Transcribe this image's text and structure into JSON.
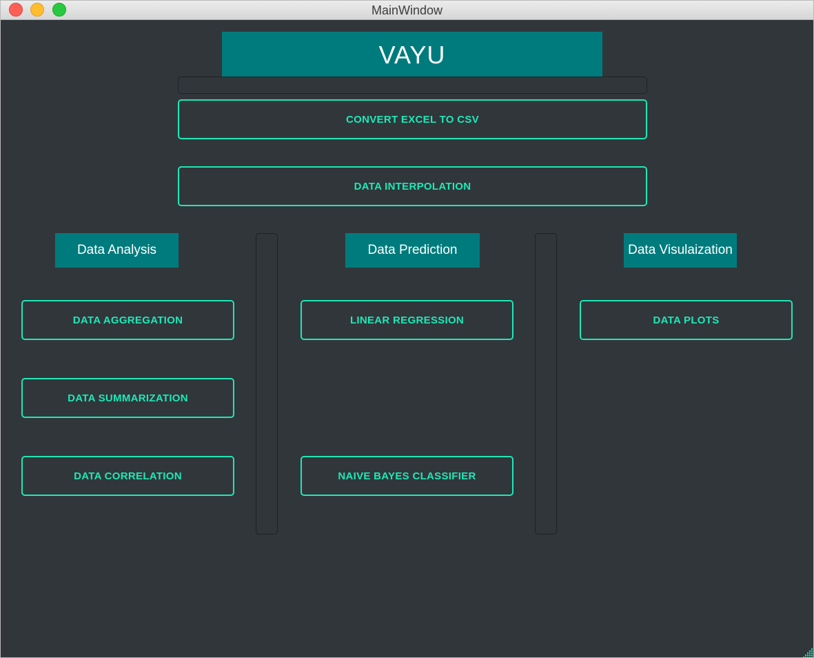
{
  "window": {
    "title": "MainWindow"
  },
  "banner": {
    "title": "VAYU"
  },
  "top_actions": {
    "convert_excel_to_csv": "CONVERT EXCEL TO CSV",
    "data_interpolation": "DATA INTERPOLATION"
  },
  "sections": {
    "analysis": {
      "label": "Data Analysis",
      "buttons": [
        "DATA AGGREGATION",
        "DATA SUMMARIZATION",
        "DATA CORRELATION"
      ]
    },
    "prediction": {
      "label": "Data Prediction",
      "buttons": [
        "LINEAR REGRESSION",
        "NAIVE BAYES CLASSIFIER"
      ]
    },
    "visualization": {
      "label": "Data Visulaization",
      "buttons": [
        "DATA PLOTS"
      ]
    }
  },
  "colors": {
    "background": "#31363b",
    "accent": "#1de9b6",
    "banner": "#007b7d"
  },
  "icons": {
    "close": "close-icon",
    "minimize": "minimize-icon",
    "zoom": "zoom-icon",
    "resize": "resize-grip-icon"
  }
}
